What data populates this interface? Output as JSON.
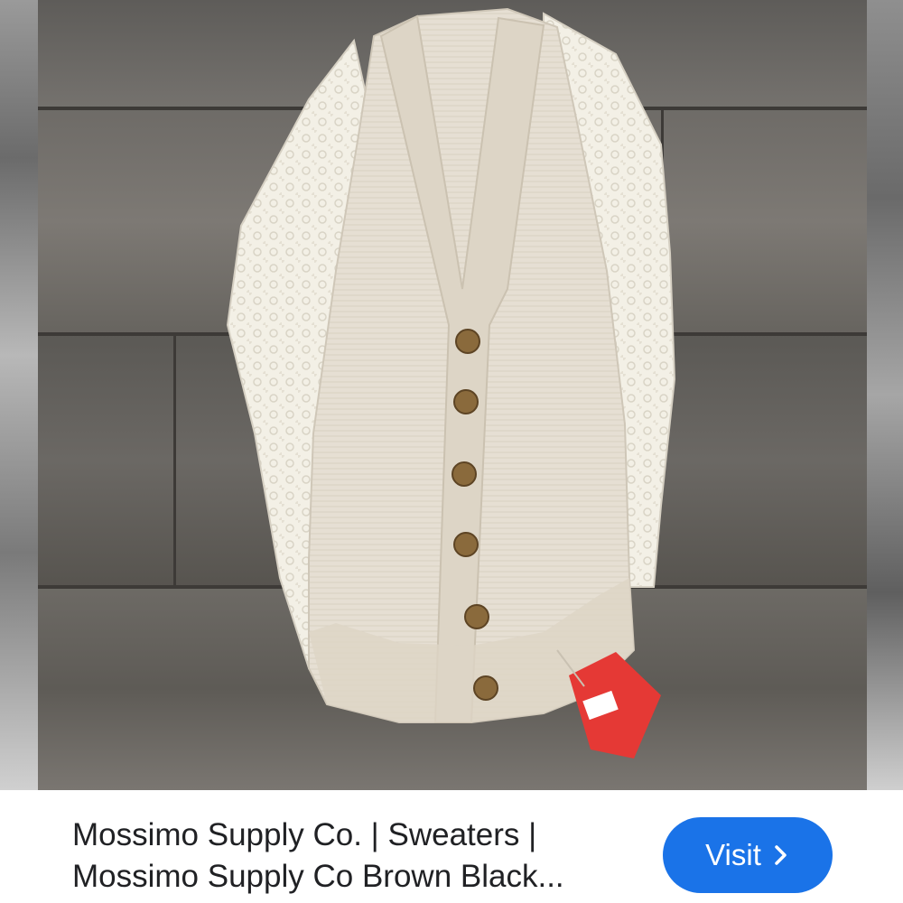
{
  "image": {
    "alt": "cardigan-photo",
    "background_color": "#6f6e6c",
    "garment_color": "#e8e2d6",
    "lace_color": "#f4f1e8",
    "button_color": "#8a6a3c",
    "tag_color": "#e53935"
  },
  "result": {
    "title_line1": "Mossimo Supply Co. | Sweaters |",
    "title_line2": "Mossimo Supply Co Brown Black..."
  },
  "visit_button": {
    "label": "Visit",
    "icon": "chevron-right-icon",
    "color": "#1a73e8"
  }
}
